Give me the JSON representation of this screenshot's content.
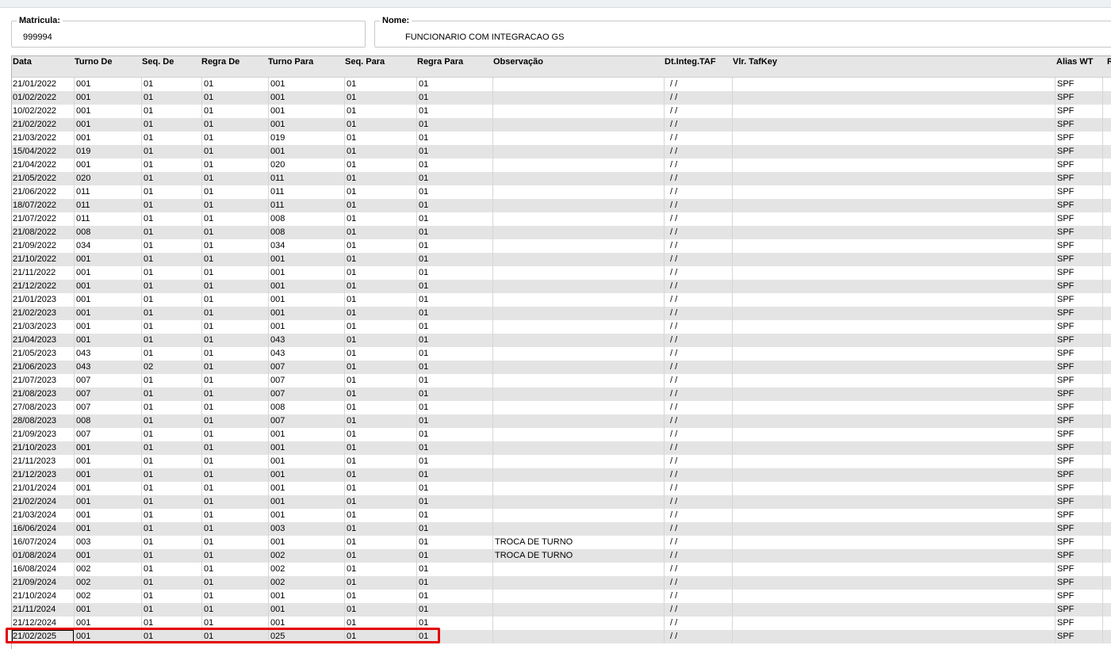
{
  "matricula": {
    "label": "Matricula:",
    "value": "999994"
  },
  "nome": {
    "label": "Nome:",
    "value": "FUNCIONARIO COM INTEGRACAO GS"
  },
  "columns": [
    "Data",
    "Turno De",
    "Seq. De",
    "Regra De",
    "Turno Para",
    "Seq. Para",
    "Regra Para",
    "Observação",
    "Dt.Integ.TAF",
    "Vlr. TafKey",
    "Alias WT",
    "Re"
  ],
  "rows": [
    {
      "data": "21/01/2022",
      "turno_de": "001",
      "seq_de": "01",
      "regra_de": "01",
      "turno_para": "001",
      "seq_para": "01",
      "regra_para": "01",
      "obs": "",
      "dt_integ": "/ /",
      "tafkey": "",
      "alias": "SPF"
    },
    {
      "data": "01/02/2022",
      "turno_de": "001",
      "seq_de": "01",
      "regra_de": "01",
      "turno_para": "001",
      "seq_para": "01",
      "regra_para": "01",
      "obs": "",
      "dt_integ": "/ /",
      "tafkey": "",
      "alias": "SPF"
    },
    {
      "data": "10/02/2022",
      "turno_de": "001",
      "seq_de": "01",
      "regra_de": "01",
      "turno_para": "001",
      "seq_para": "01",
      "regra_para": "01",
      "obs": "",
      "dt_integ": "/ /",
      "tafkey": "",
      "alias": "SPF"
    },
    {
      "data": "21/02/2022",
      "turno_de": "001",
      "seq_de": "01",
      "regra_de": "01",
      "turno_para": "001",
      "seq_para": "01",
      "regra_para": "01",
      "obs": "",
      "dt_integ": "/ /",
      "tafkey": "",
      "alias": "SPF"
    },
    {
      "data": "21/03/2022",
      "turno_de": "001",
      "seq_de": "01",
      "regra_de": "01",
      "turno_para": "019",
      "seq_para": "01",
      "regra_para": "01",
      "obs": "",
      "dt_integ": "/ /",
      "tafkey": "",
      "alias": "SPF"
    },
    {
      "data": "15/04/2022",
      "turno_de": "019",
      "seq_de": "01",
      "regra_de": "01",
      "turno_para": "001",
      "seq_para": "01",
      "regra_para": "01",
      "obs": "",
      "dt_integ": "/ /",
      "tafkey": "",
      "alias": "SPF"
    },
    {
      "data": "21/04/2022",
      "turno_de": "001",
      "seq_de": "01",
      "regra_de": "01",
      "turno_para": "020",
      "seq_para": "01",
      "regra_para": "01",
      "obs": "",
      "dt_integ": "/ /",
      "tafkey": "",
      "alias": "SPF"
    },
    {
      "data": "21/05/2022",
      "turno_de": "020",
      "seq_de": "01",
      "regra_de": "01",
      "turno_para": "011",
      "seq_para": "01",
      "regra_para": "01",
      "obs": "",
      "dt_integ": "/ /",
      "tafkey": "",
      "alias": "SPF"
    },
    {
      "data": "21/06/2022",
      "turno_de": "011",
      "seq_de": "01",
      "regra_de": "01",
      "turno_para": "011",
      "seq_para": "01",
      "regra_para": "01",
      "obs": "",
      "dt_integ": "/ /",
      "tafkey": "",
      "alias": "SPF"
    },
    {
      "data": "18/07/2022",
      "turno_de": "011",
      "seq_de": "01",
      "regra_de": "01",
      "turno_para": "011",
      "seq_para": "01",
      "regra_para": "01",
      "obs": "",
      "dt_integ": "/ /",
      "tafkey": "",
      "alias": "SPF"
    },
    {
      "data": "21/07/2022",
      "turno_de": "011",
      "seq_de": "01",
      "regra_de": "01",
      "turno_para": "008",
      "seq_para": "01",
      "regra_para": "01",
      "obs": "",
      "dt_integ": "/ /",
      "tafkey": "",
      "alias": "SPF"
    },
    {
      "data": "21/08/2022",
      "turno_de": "008",
      "seq_de": "01",
      "regra_de": "01",
      "turno_para": "008",
      "seq_para": "01",
      "regra_para": "01",
      "obs": "",
      "dt_integ": "/ /",
      "tafkey": "",
      "alias": "SPF"
    },
    {
      "data": "21/09/2022",
      "turno_de": "034",
      "seq_de": "01",
      "regra_de": "01",
      "turno_para": "034",
      "seq_para": "01",
      "regra_para": "01",
      "obs": "",
      "dt_integ": "/ /",
      "tafkey": "",
      "alias": "SPF"
    },
    {
      "data": "21/10/2022",
      "turno_de": "001",
      "seq_de": "01",
      "regra_de": "01",
      "turno_para": "001",
      "seq_para": "01",
      "regra_para": "01",
      "obs": "",
      "dt_integ": "/ /",
      "tafkey": "",
      "alias": "SPF"
    },
    {
      "data": "21/11/2022",
      "turno_de": "001",
      "seq_de": "01",
      "regra_de": "01",
      "turno_para": "001",
      "seq_para": "01",
      "regra_para": "01",
      "obs": "",
      "dt_integ": "/ /",
      "tafkey": "",
      "alias": "SPF"
    },
    {
      "data": "21/12/2022",
      "turno_de": "001",
      "seq_de": "01",
      "regra_de": "01",
      "turno_para": "001",
      "seq_para": "01",
      "regra_para": "01",
      "obs": "",
      "dt_integ": "/ /",
      "tafkey": "",
      "alias": "SPF"
    },
    {
      "data": "21/01/2023",
      "turno_de": "001",
      "seq_de": "01",
      "regra_de": "01",
      "turno_para": "001",
      "seq_para": "01",
      "regra_para": "01",
      "obs": "",
      "dt_integ": "/ /",
      "tafkey": "",
      "alias": "SPF"
    },
    {
      "data": "21/02/2023",
      "turno_de": "001",
      "seq_de": "01",
      "regra_de": "01",
      "turno_para": "001",
      "seq_para": "01",
      "regra_para": "01",
      "obs": "",
      "dt_integ": "/ /",
      "tafkey": "",
      "alias": "SPF"
    },
    {
      "data": "21/03/2023",
      "turno_de": "001",
      "seq_de": "01",
      "regra_de": "01",
      "turno_para": "001",
      "seq_para": "01",
      "regra_para": "01",
      "obs": "",
      "dt_integ": "/ /",
      "tafkey": "",
      "alias": "SPF"
    },
    {
      "data": "21/04/2023",
      "turno_de": "001",
      "seq_de": "01",
      "regra_de": "01",
      "turno_para": "043",
      "seq_para": "01",
      "regra_para": "01",
      "obs": "",
      "dt_integ": "/ /",
      "tafkey": "",
      "alias": "SPF"
    },
    {
      "data": "21/05/2023",
      "turno_de": "043",
      "seq_de": "01",
      "regra_de": "01",
      "turno_para": "043",
      "seq_para": "01",
      "regra_para": "01",
      "obs": "",
      "dt_integ": "/ /",
      "tafkey": "",
      "alias": "SPF"
    },
    {
      "data": "21/06/2023",
      "turno_de": "043",
      "seq_de": "02",
      "regra_de": "01",
      "turno_para": "007",
      "seq_para": "01",
      "regra_para": "01",
      "obs": "",
      "dt_integ": "/ /",
      "tafkey": "",
      "alias": "SPF"
    },
    {
      "data": "21/07/2023",
      "turno_de": "007",
      "seq_de": "01",
      "regra_de": "01",
      "turno_para": "007",
      "seq_para": "01",
      "regra_para": "01",
      "obs": "",
      "dt_integ": "/ /",
      "tafkey": "",
      "alias": "SPF"
    },
    {
      "data": "21/08/2023",
      "turno_de": "007",
      "seq_de": "01",
      "regra_de": "01",
      "turno_para": "007",
      "seq_para": "01",
      "regra_para": "01",
      "obs": "",
      "dt_integ": "/ /",
      "tafkey": "",
      "alias": "SPF"
    },
    {
      "data": "27/08/2023",
      "turno_de": "007",
      "seq_de": "01",
      "regra_de": "01",
      "turno_para": "008",
      "seq_para": "01",
      "regra_para": "01",
      "obs": "",
      "dt_integ": "/ /",
      "tafkey": "",
      "alias": "SPF"
    },
    {
      "data": "28/08/2023",
      "turno_de": "008",
      "seq_de": "01",
      "regra_de": "01",
      "turno_para": "007",
      "seq_para": "01",
      "regra_para": "01",
      "obs": "",
      "dt_integ": "/ /",
      "tafkey": "",
      "alias": "SPF"
    },
    {
      "data": "21/09/2023",
      "turno_de": "007",
      "seq_de": "01",
      "regra_de": "01",
      "turno_para": "001",
      "seq_para": "01",
      "regra_para": "01",
      "obs": "",
      "dt_integ": "/ /",
      "tafkey": "",
      "alias": "SPF"
    },
    {
      "data": "21/10/2023",
      "turno_de": "001",
      "seq_de": "01",
      "regra_de": "01",
      "turno_para": "001",
      "seq_para": "01",
      "regra_para": "01",
      "obs": "",
      "dt_integ": "/ /",
      "tafkey": "",
      "alias": "SPF"
    },
    {
      "data": "21/11/2023",
      "turno_de": "001",
      "seq_de": "01",
      "regra_de": "01",
      "turno_para": "001",
      "seq_para": "01",
      "regra_para": "01",
      "obs": "",
      "dt_integ": "/ /",
      "tafkey": "",
      "alias": "SPF"
    },
    {
      "data": "21/12/2023",
      "turno_de": "001",
      "seq_de": "01",
      "regra_de": "01",
      "turno_para": "001",
      "seq_para": "01",
      "regra_para": "01",
      "obs": "",
      "dt_integ": "/ /",
      "tafkey": "",
      "alias": "SPF"
    },
    {
      "data": "21/01/2024",
      "turno_de": "001",
      "seq_de": "01",
      "regra_de": "01",
      "turno_para": "001",
      "seq_para": "01",
      "regra_para": "01",
      "obs": "",
      "dt_integ": "/ /",
      "tafkey": "",
      "alias": "SPF"
    },
    {
      "data": "21/02/2024",
      "turno_de": "001",
      "seq_de": "01",
      "regra_de": "01",
      "turno_para": "001",
      "seq_para": "01",
      "regra_para": "01",
      "obs": "",
      "dt_integ": "/ /",
      "tafkey": "",
      "alias": "SPF"
    },
    {
      "data": "21/03/2024",
      "turno_de": "001",
      "seq_de": "01",
      "regra_de": "01",
      "turno_para": "001",
      "seq_para": "01",
      "regra_para": "01",
      "obs": "",
      "dt_integ": "/ /",
      "tafkey": "",
      "alias": "SPF"
    },
    {
      "data": "16/06/2024",
      "turno_de": "001",
      "seq_de": "01",
      "regra_de": "01",
      "turno_para": "003",
      "seq_para": "01",
      "regra_para": "01",
      "obs": "",
      "dt_integ": "/ /",
      "tafkey": "",
      "alias": "SPF"
    },
    {
      "data": "16/07/2024",
      "turno_de": "003",
      "seq_de": "01",
      "regra_de": "01",
      "turno_para": "001",
      "seq_para": "01",
      "regra_para": "01",
      "obs": "TROCA DE TURNO",
      "dt_integ": "/ /",
      "tafkey": "",
      "alias": "SPF"
    },
    {
      "data": "01/08/2024",
      "turno_de": "001",
      "seq_de": "01",
      "regra_de": "01",
      "turno_para": "002",
      "seq_para": "01",
      "regra_para": "01",
      "obs": "TROCA DE TURNO",
      "dt_integ": "/ /",
      "tafkey": "",
      "alias": "SPF"
    },
    {
      "data": "16/08/2024",
      "turno_de": "002",
      "seq_de": "01",
      "regra_de": "01",
      "turno_para": "002",
      "seq_para": "01",
      "regra_para": "01",
      "obs": "",
      "dt_integ": "/ /",
      "tafkey": "",
      "alias": "SPF"
    },
    {
      "data": "21/09/2024",
      "turno_de": "002",
      "seq_de": "01",
      "regra_de": "01",
      "turno_para": "002",
      "seq_para": "01",
      "regra_para": "01",
      "obs": "",
      "dt_integ": "/ /",
      "tafkey": "",
      "alias": "SPF"
    },
    {
      "data": "21/10/2024",
      "turno_de": "002",
      "seq_de": "01",
      "regra_de": "01",
      "turno_para": "001",
      "seq_para": "01",
      "regra_para": "01",
      "obs": "",
      "dt_integ": "/ /",
      "tafkey": "",
      "alias": "SPF"
    },
    {
      "data": "21/11/2024",
      "turno_de": "001",
      "seq_de": "01",
      "regra_de": "01",
      "turno_para": "001",
      "seq_para": "01",
      "regra_para": "01",
      "obs": "",
      "dt_integ": "/ /",
      "tafkey": "",
      "alias": "SPF"
    },
    {
      "data": "21/12/2024",
      "turno_de": "001",
      "seq_de": "01",
      "regra_de": "01",
      "turno_para": "001",
      "seq_para": "01",
      "regra_para": "01",
      "obs": "",
      "dt_integ": "/ /",
      "tafkey": "",
      "alias": "SPF"
    },
    {
      "data": "21/02/2025",
      "turno_de": "001",
      "seq_de": "01",
      "regra_de": "01",
      "turno_para": "025",
      "seq_para": "01",
      "regra_para": "01",
      "obs": "",
      "dt_integ": "/ /",
      "tafkey": "",
      "alias": "SPF"
    }
  ],
  "colors": {
    "row_alt": "#e4e4e4",
    "highlight": "#e30000"
  }
}
